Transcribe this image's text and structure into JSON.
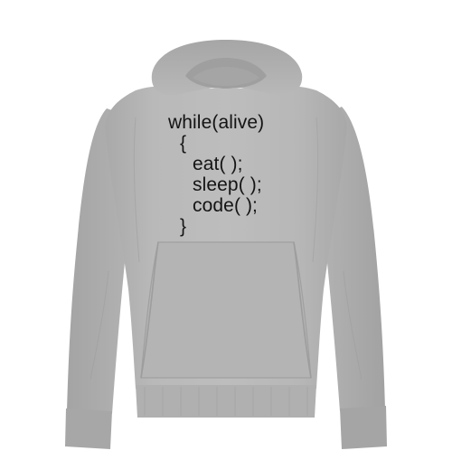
{
  "product": {
    "color_hex": "#b6b6b6",
    "print_color_hex": "#141414",
    "print_lines": [
      "while(alive)",
      "{",
      "eat( );",
      "sleep( );",
      "code( );",
      "}"
    ]
  }
}
